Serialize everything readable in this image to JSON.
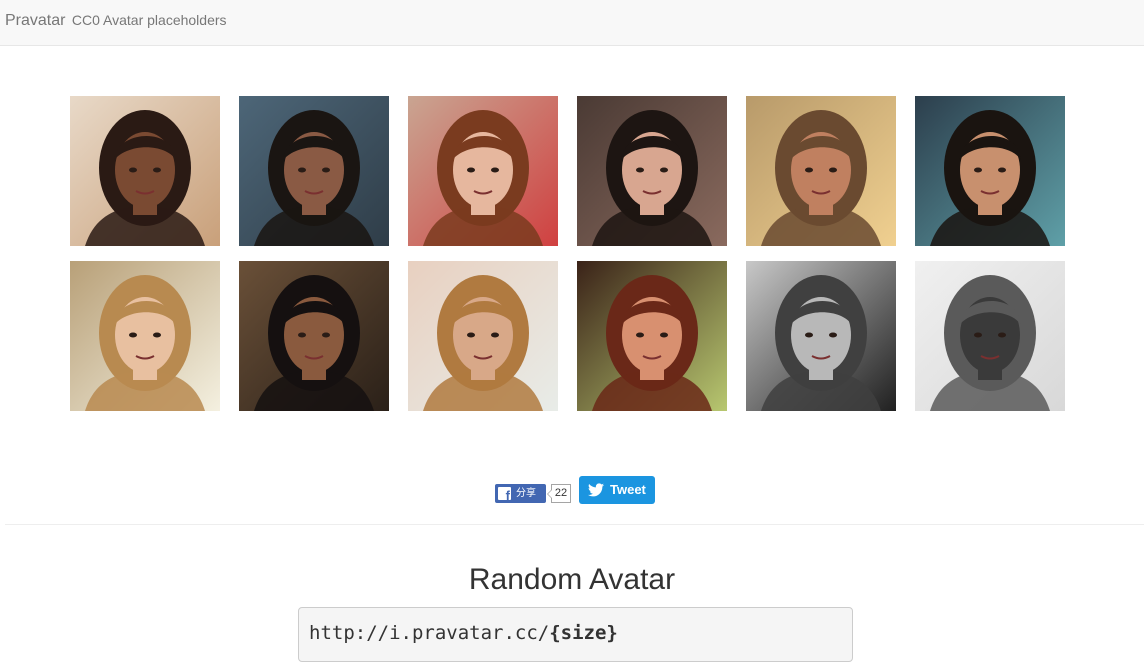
{
  "navbar": {
    "brand": "Pravatar",
    "tagline": "CC0 Avatar placeholders"
  },
  "avatars": [
    {
      "name": "avatar-1",
      "bg": "#e8d9c8",
      "skin": "#7a4a32",
      "hair": "#2a1a14",
      "accent": "#c9a07a"
    },
    {
      "name": "avatar-2",
      "bg": "#4d6678",
      "skin": "#8a5a44",
      "hair": "#1a1512",
      "accent": "#2f3d48"
    },
    {
      "name": "avatar-3",
      "bg": "#c9a592",
      "skin": "#e6b79e",
      "hair": "#7a3b1f",
      "accent": "#d04040"
    },
    {
      "name": "avatar-4",
      "bg": "#4a3a34",
      "skin": "#d8a690",
      "hair": "#1d1512",
      "accent": "#8a6a5e"
    },
    {
      "name": "avatar-5",
      "bg": "#b89a6a",
      "skin": "#c08060",
      "hair": "#6a4a30",
      "accent": "#f0d090"
    },
    {
      "name": "avatar-6",
      "bg": "#2c3e4c",
      "skin": "#c8906e",
      "hair": "#1a1410",
      "accent": "#5fa0a8"
    },
    {
      "name": "avatar-7",
      "bg": "#b8a078",
      "skin": "#e8c0a0",
      "hair": "#b88a50",
      "accent": "#f4f0e0"
    },
    {
      "name": "avatar-8",
      "bg": "#6a5038",
      "skin": "#8a5a3e",
      "hair": "#151010",
      "accent": "#2a2018"
    },
    {
      "name": "avatar-9",
      "bg": "#e8d0c0",
      "skin": "#d8a888",
      "hair": "#b07a40",
      "accent": "#e8ece8"
    },
    {
      "name": "avatar-10",
      "bg": "#3a2218",
      "skin": "#d89070",
      "hair": "#6a2818",
      "accent": "#b8c870"
    },
    {
      "name": "avatar-11",
      "bg": "#c8c8c8",
      "skin": "#b8b8b8",
      "hair": "#404040",
      "accent": "#202020"
    },
    {
      "name": "avatar-12",
      "bg": "#f0f0f0",
      "skin": "#3a3a3a",
      "hair": "#5a5a5a",
      "accent": "#d8d8d8"
    }
  ],
  "share": {
    "facebook_label": "分享",
    "facebook_count": "22",
    "tweet_label": "Tweet"
  },
  "section": {
    "title": "Random Avatar",
    "code_prefix": "http://i.pravatar.cc/",
    "code_param": "{size}"
  },
  "colors": {
    "facebook": "#4267b2",
    "twitter": "#1b95e0",
    "navbar_bg": "#f8f8f8"
  }
}
